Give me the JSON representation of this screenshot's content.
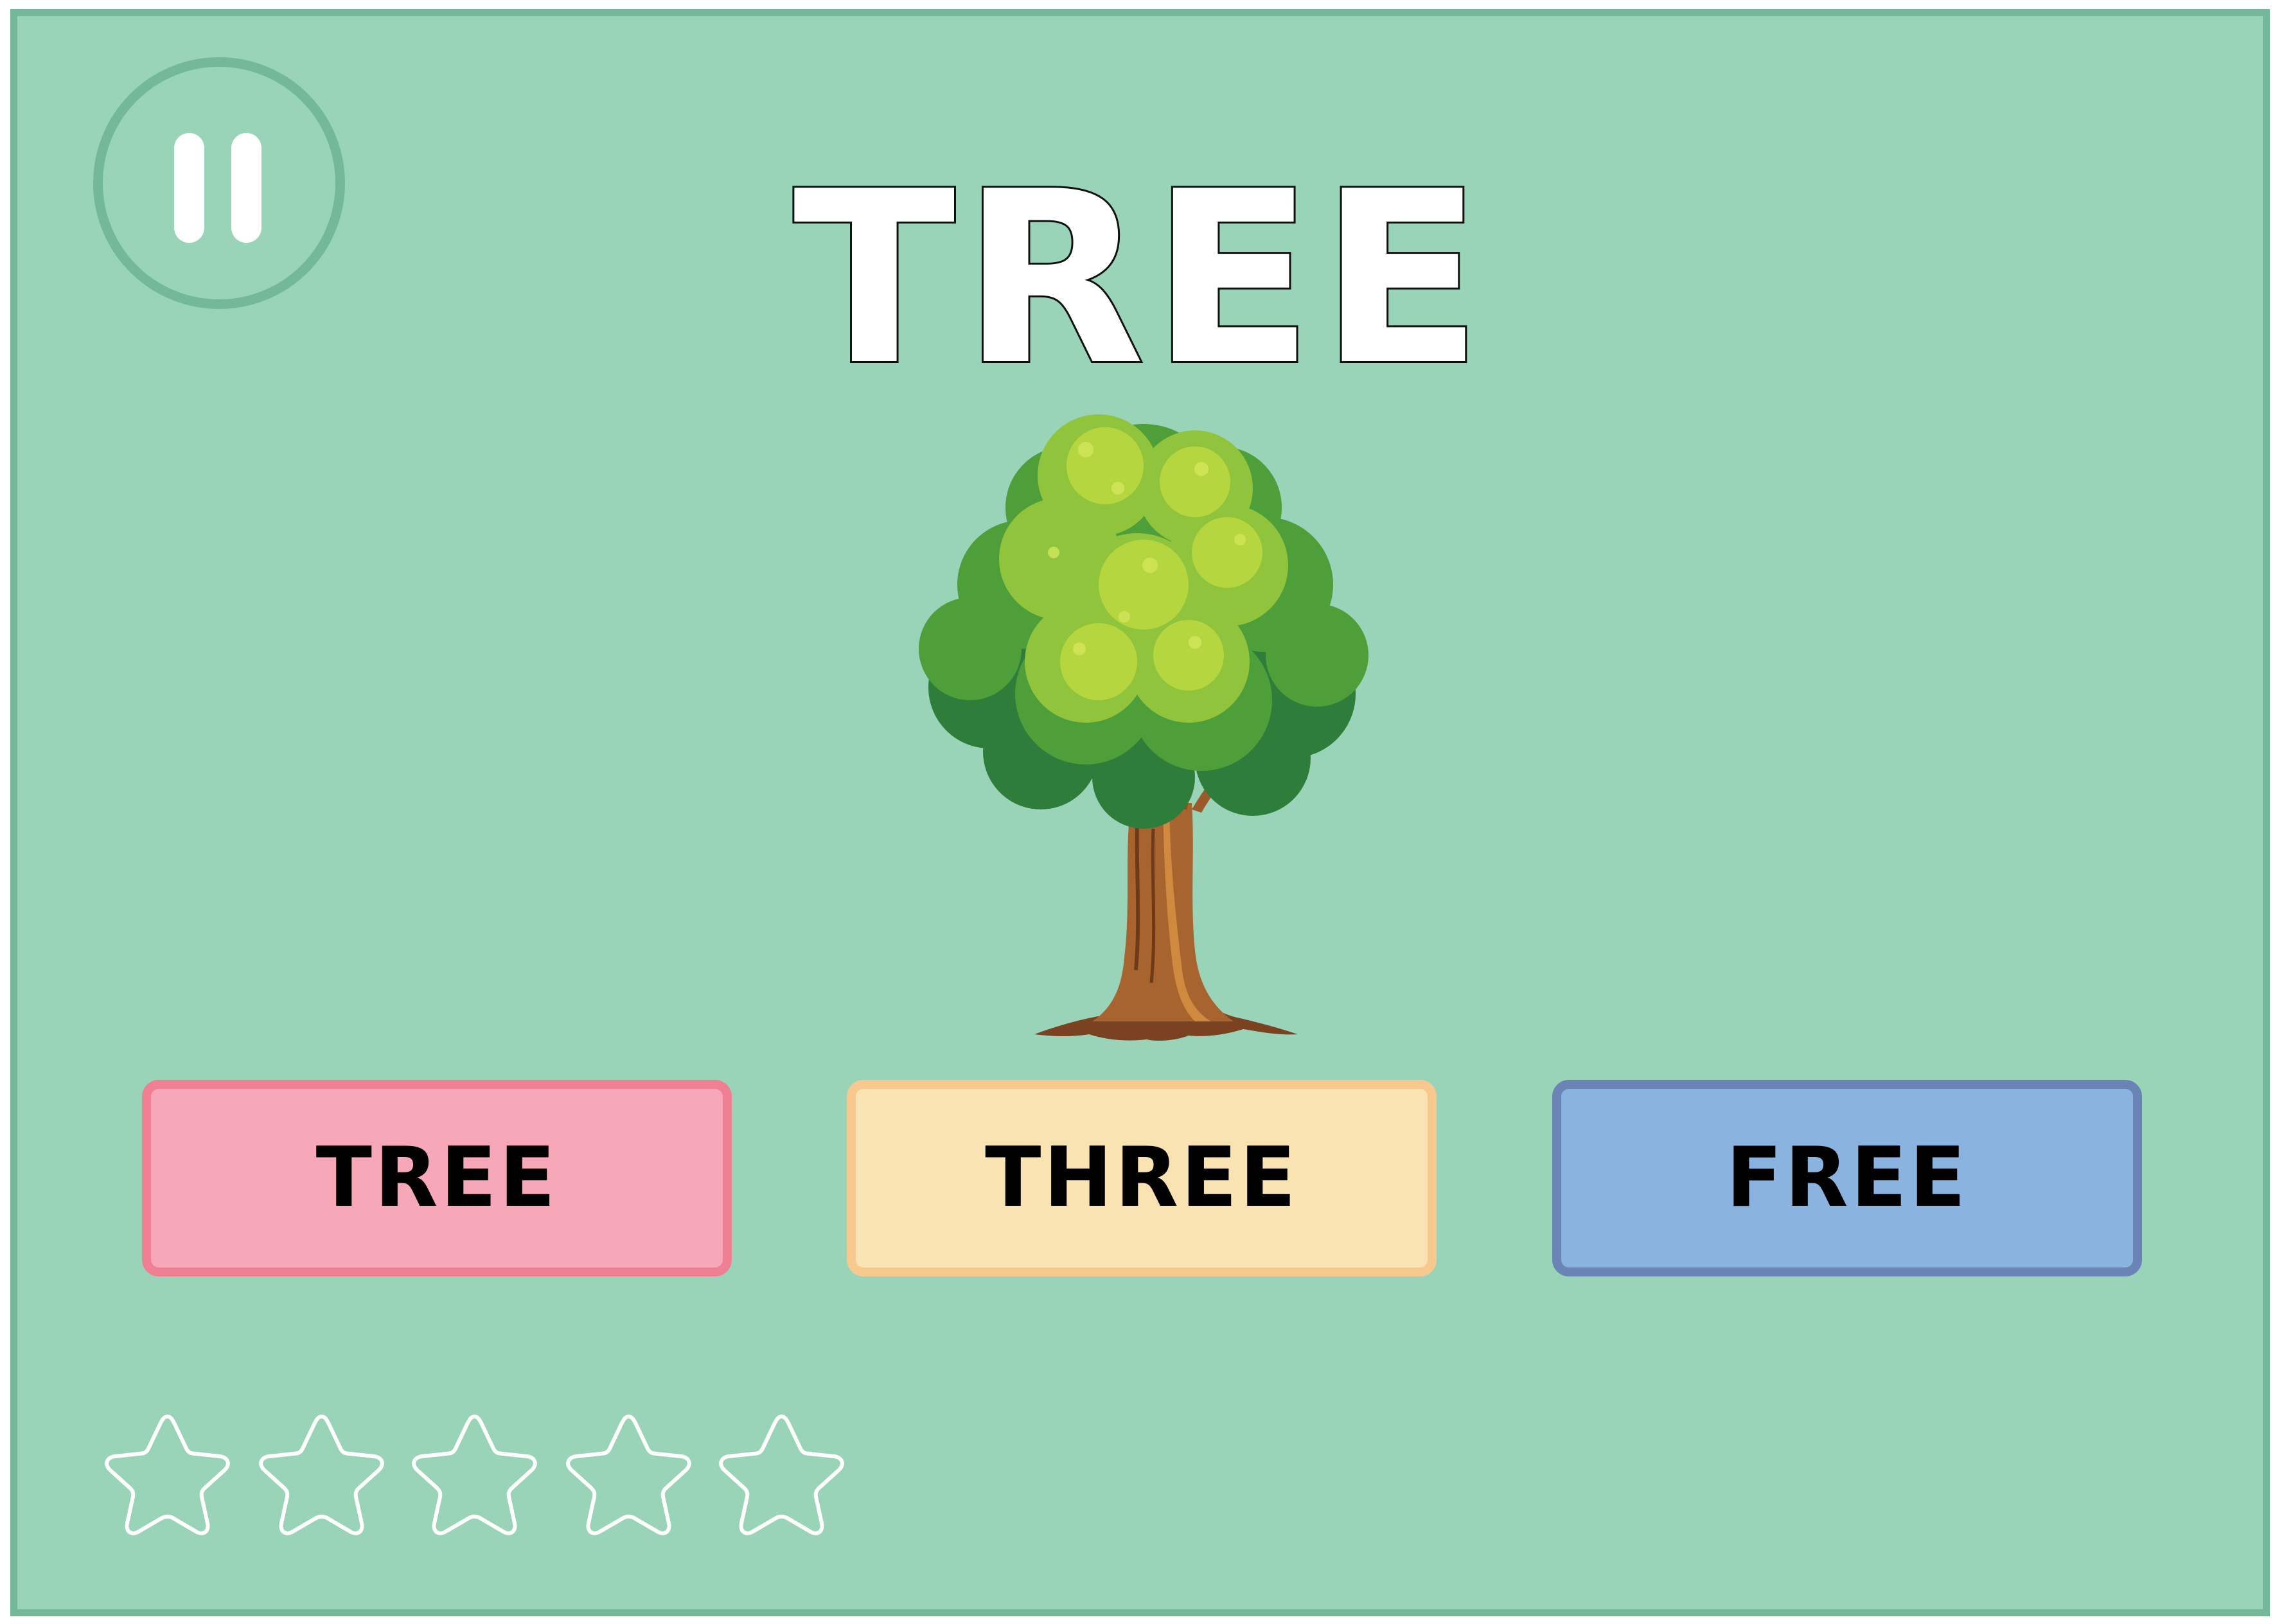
{
  "game": {
    "target_word": "TREE",
    "picture": "tree",
    "answers": [
      {
        "label": "TREE",
        "color": "#f7a8b8"
      },
      {
        "label": "THREE",
        "color": "#fae3b3"
      },
      {
        "label": "FREE",
        "color": "#8ab3e0"
      }
    ],
    "stars_total": 5,
    "stars_filled": 0
  },
  "icons": {
    "pause": "pause-icon",
    "star": "star-outline-icon"
  },
  "colors": {
    "background": "#99d4b9",
    "frame_border": "#74b89a"
  }
}
